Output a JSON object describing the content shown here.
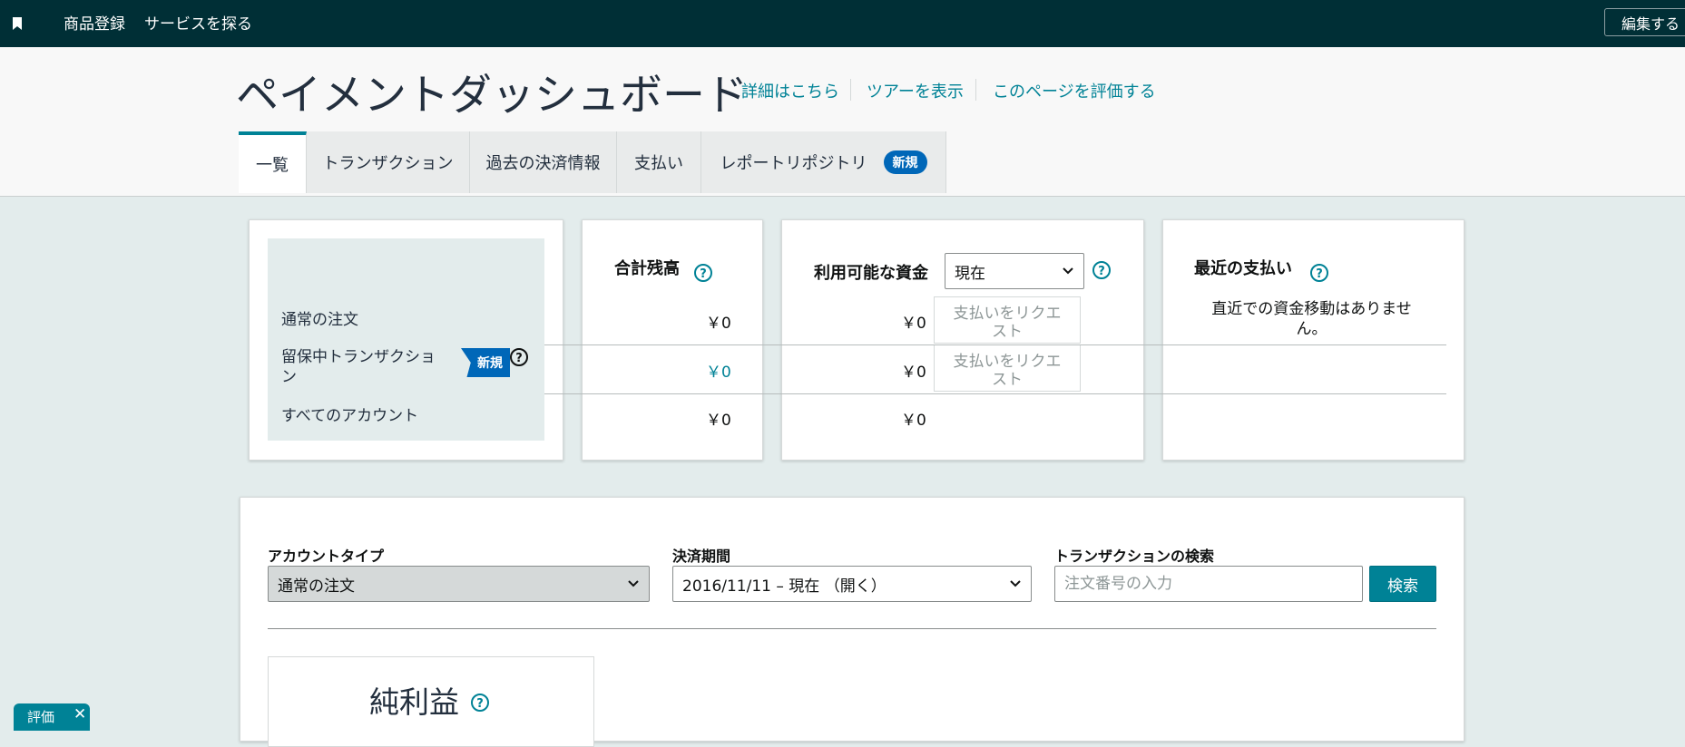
{
  "topbar": {
    "icon": "bookmark-icon",
    "nav": [
      "商品登録",
      "サービスを探る"
    ],
    "edit_label": "編集する"
  },
  "header": {
    "title": "ペイメントダッシュボード",
    "links": [
      "詳細はこちら",
      "ツアーを表示",
      "このページを評価する"
    ]
  },
  "tabs": [
    {
      "label": "一覧",
      "active": true
    },
    {
      "label": "トランザクション",
      "active": false
    },
    {
      "label": "過去の決済情報",
      "active": false
    },
    {
      "label": "支払い",
      "active": false
    },
    {
      "label": "レポートリポジトリ",
      "badge": "新規",
      "active": false
    }
  ],
  "summary": {
    "rows": [
      {
        "label": "通常の注文"
      },
      {
        "label": "留保中トランザクション",
        "badge": "新規"
      },
      {
        "label": "すべてのアカウント"
      }
    ],
    "total_balance": {
      "title": "合計残高",
      "values": [
        "￥0",
        "￥0",
        "￥0"
      ]
    },
    "available_funds": {
      "title": "利用可能な資金",
      "select_value": "現在",
      "values": [
        "￥0",
        "￥0",
        "￥0"
      ],
      "request_label": "支払いをリクエスト"
    },
    "recent_payouts": {
      "title": "最近の支払い",
      "empty_text": "直近での資金移動はありません。"
    }
  },
  "filters": {
    "account_type": {
      "label": "アカウントタイプ",
      "value": "通常の注文"
    },
    "settlement_period": {
      "label": "決済期間",
      "value": "2016/11/11 – 現在 （開く）"
    },
    "search": {
      "label": "トランザクションの検索",
      "placeholder": "注文番号の入力",
      "button": "検索"
    }
  },
  "net_profit": {
    "title": "純利益"
  },
  "feedback": {
    "label": "評価",
    "close": "✕"
  },
  "colors": {
    "topbar": "#002f36",
    "accent": "#008296",
    "badge": "#0067b8",
    "page_bg": "#e3ecec"
  }
}
